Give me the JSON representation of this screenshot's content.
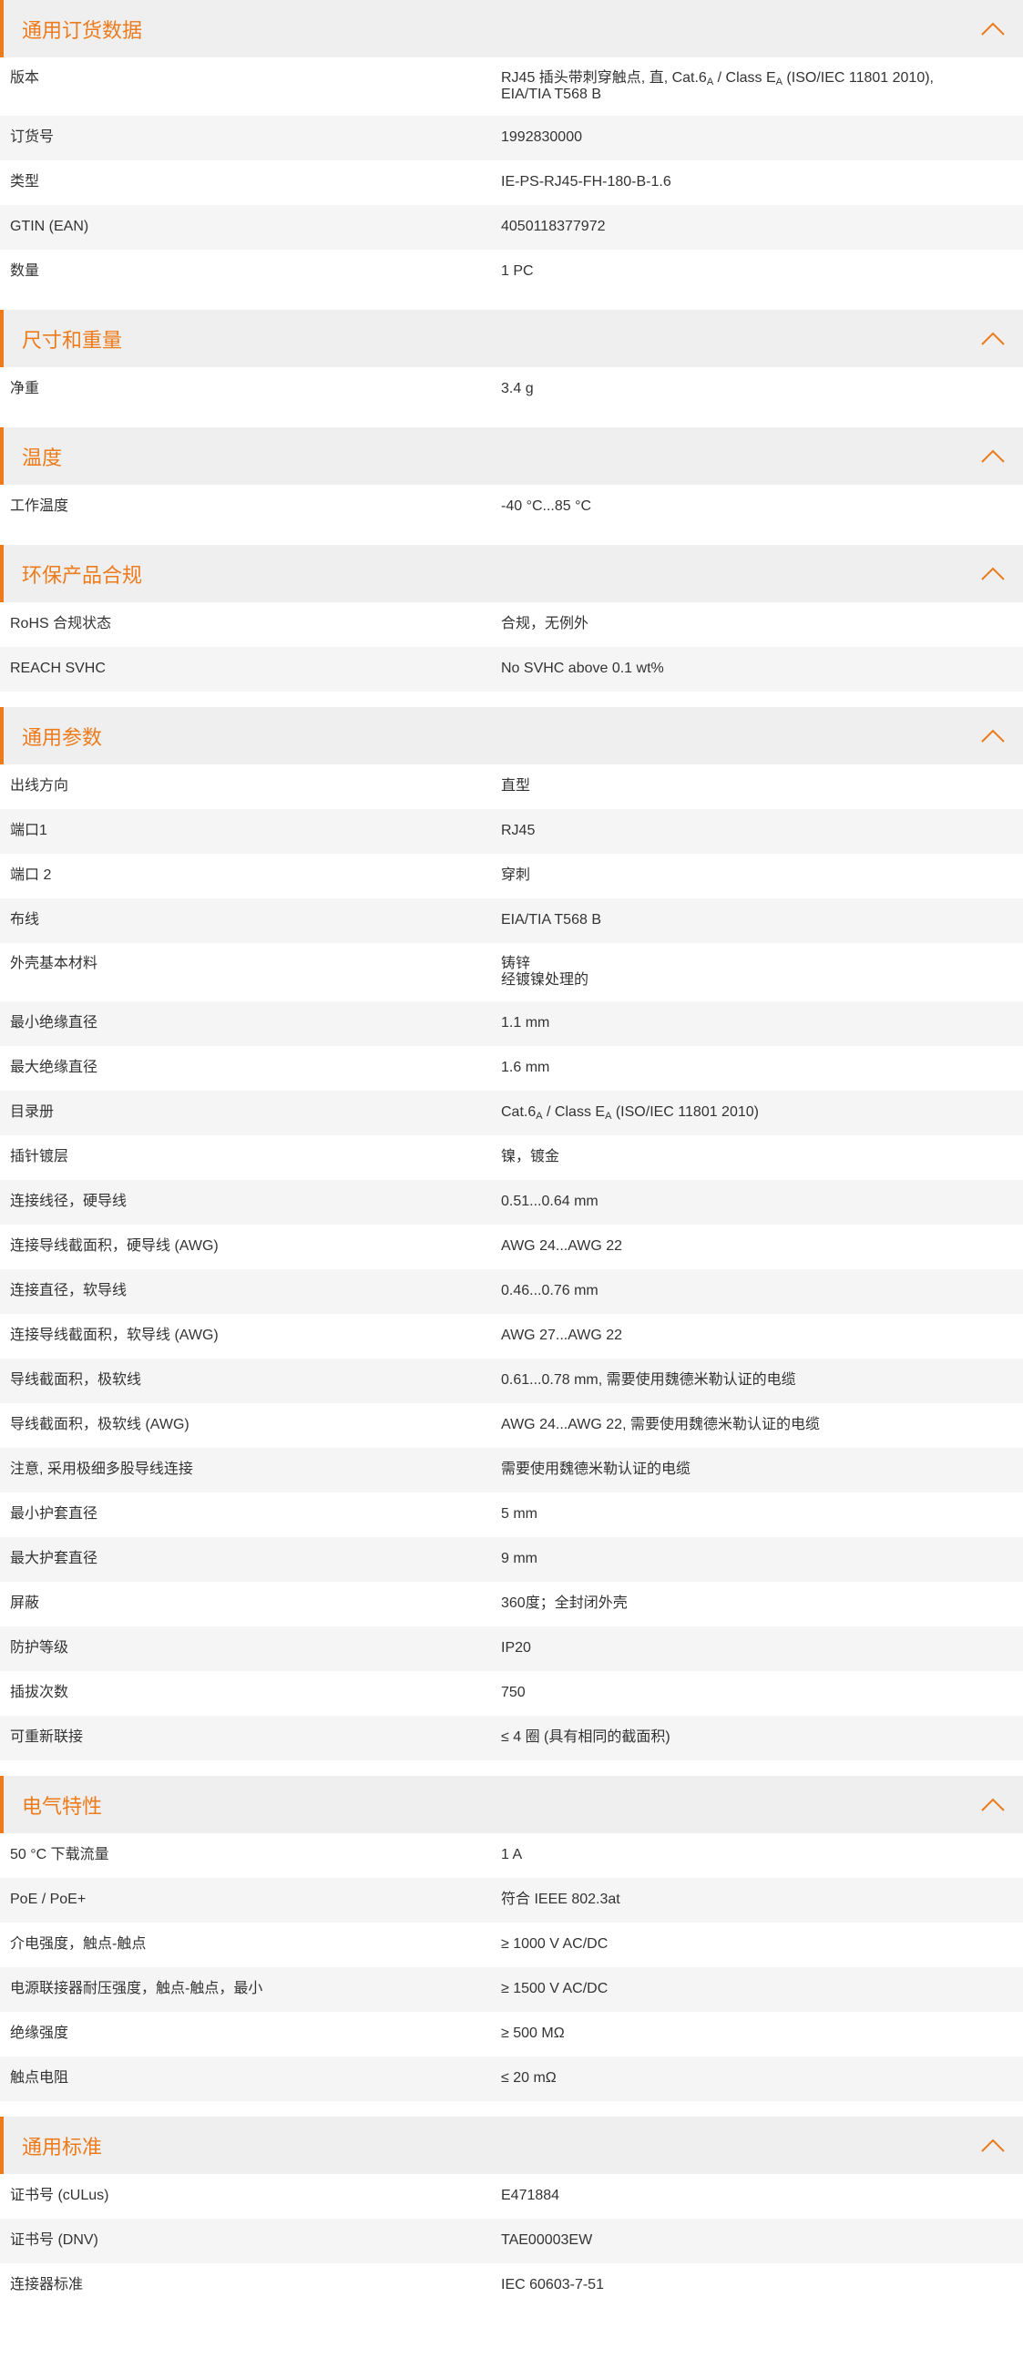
{
  "accent": "#ec7b1c",
  "icon": "chevron-up-icon",
  "sections": [
    {
      "title": "通用订货数据",
      "rows": [
        {
          "label": "版本",
          "value": "RJ45 插头带刺穿触点, 直, Cat.6A / Class EA (ISO/IEC 11801 2010), EIA/TIA T568 B",
          "html": "RJ45 插头带刺穿触点, 直, Cat.6<sub>A</sub> / Class E<sub>A</sub> (ISO/IEC 11801 2010),<br>EIA/TIA T568 B",
          "tall": true
        },
        {
          "label": "订货号",
          "value": "1992830000"
        },
        {
          "label": "类型",
          "value": "IE-PS-RJ45-FH-180-B-1.6"
        },
        {
          "label": "GTIN (EAN)",
          "value": "4050118377972"
        },
        {
          "label": "数量",
          "value": "1  PC"
        }
      ]
    },
    {
      "title": "尺寸和重量",
      "rows": [
        {
          "label": "净重",
          "value": "3.4  g"
        }
      ]
    },
    {
      "title": "温度",
      "rows": [
        {
          "label": "工作温度",
          "value": "-40 °C...85 °C"
        }
      ]
    },
    {
      "title": "环保产品合规",
      "rows": [
        {
          "label": "RoHS 合规状态",
          "value": "合规，无例外"
        },
        {
          "label": "REACH SVHC",
          "value": "No SVHC above 0.1 wt%"
        }
      ]
    },
    {
      "title": "通用参数",
      "rows": [
        {
          "label": "出线方向",
          "value": "直型"
        },
        {
          "label": "端口1",
          "value": "RJ45"
        },
        {
          "label": "端口 2",
          "value": "穿刺"
        },
        {
          "label": "布线",
          "value": "EIA/TIA T568 B"
        },
        {
          "label": "外壳基本材料",
          "value": "铸锌\n经镀镍处理的",
          "html": "铸锌<br>经镀镍处理的",
          "tall": true
        },
        {
          "label": "最小绝缘直径",
          "value": "1.1  mm"
        },
        {
          "label": "最大绝缘直径",
          "value": "1.6  mm"
        },
        {
          "label": "目录册",
          "value": "Cat.6A / Class EA (ISO/IEC 11801 2010)",
          "html": "Cat.6<sub>A</sub> / Class E<sub>A</sub> (ISO/IEC 11801 2010)"
        },
        {
          "label": "插针镀层",
          "value": "镍，镀金"
        },
        {
          "label": "连接线径，硬导线",
          "value": "0.51...0.64 mm"
        },
        {
          "label": "连接导线截面积，硬导线 (AWG)",
          "value": "AWG 24...AWG 22"
        },
        {
          "label": "连接直径，软导线",
          "value": "0.46...0.76 mm"
        },
        {
          "label": "连接导线截面积，软导线 (AWG)",
          "value": "AWG 27...AWG 22"
        },
        {
          "label": "导线截面积，极软线",
          "value": "0.61...0.78 mm, 需要使用魏德米勒认证的电缆"
        },
        {
          "label": "导线截面积，极软线 (AWG)",
          "value": "AWG 24...AWG 22, 需要使用魏德米勒认证的电缆"
        },
        {
          "label": "注意, 采用极细多股导线连接",
          "value": "需要使用魏德米勒认证的电缆"
        },
        {
          "label": "最小护套直径",
          "value": "5  mm"
        },
        {
          "label": "最大护套直径",
          "value": "9  mm"
        },
        {
          "label": "屏蔽",
          "value": "360度；全封闭外壳"
        },
        {
          "label": "防护等级",
          "value": "IP20"
        },
        {
          "label": "插拔次数",
          "value": "750"
        },
        {
          "label": "可重新联接",
          "value": "≤ 4 圈 (具有相同的截面积)"
        }
      ]
    },
    {
      "title": "电气特性",
      "rows": [
        {
          "label": "50 °C 下载流量",
          "value": "1  A"
        },
        {
          "label": "PoE / PoE+",
          "value": "符合 IEEE 802.3at"
        },
        {
          "label": "介电强度，触点-触点",
          "value": "≥ 1000 V AC/DC"
        },
        {
          "label": "电源联接器耐压强度，触点-触点，最小",
          "value": "≥ 1500 V AC/DC"
        },
        {
          "label": "绝缘强度",
          "value": "≥ 500 MΩ"
        },
        {
          "label": "触点电阻",
          "value": "≤ 20 mΩ"
        }
      ]
    },
    {
      "title": "通用标准",
      "rows": [
        {
          "label": "证书号 (cULus)",
          "value": "E471884"
        },
        {
          "label": "证书号 (DNV)",
          "value": "TAE00003EW"
        },
        {
          "label": "连接器标准",
          "value": "IEC 60603-7-51"
        }
      ]
    }
  ]
}
